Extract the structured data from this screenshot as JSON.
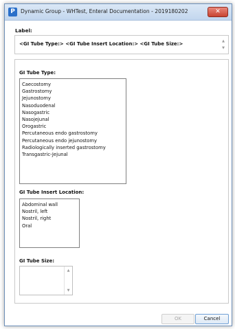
{
  "window": {
    "title": "Dynamic Group - WHTest, Enteral Documentation - 2019180202",
    "icon_letter": "P",
    "close_glyph": "✕"
  },
  "label": {
    "caption": "Label:",
    "value": "<GI Tube Type:> <GI Tube Insert Location:> <GI Tube Size:>"
  },
  "sections": {
    "tube_type": {
      "title": "GI Tube Type:",
      "options": [
        "Caecostomy",
        "Gastrostomy",
        "Jejunostomy",
        "Nasoduodenal",
        "Nasogastric",
        "Nasojejunal",
        "Orogastric",
        "Percutaneous endo gastrostomy",
        "Percutaneous endo jejunostomy",
        "Radiologically inserted gastrostomy",
        "Transgastric-Jejunal"
      ]
    },
    "insert_location": {
      "title": "GI Tube Insert Location:",
      "options": [
        "Abdominal wall",
        "Nostril, left",
        "Nostril, right",
        "Oral"
      ]
    },
    "tube_size": {
      "title": "GI Tube Size:",
      "value": ""
    }
  },
  "buttons": {
    "ok": "OK",
    "cancel": "Cancel"
  },
  "icons": {
    "scroll_up": "▲",
    "scroll_down": "▼"
  }
}
